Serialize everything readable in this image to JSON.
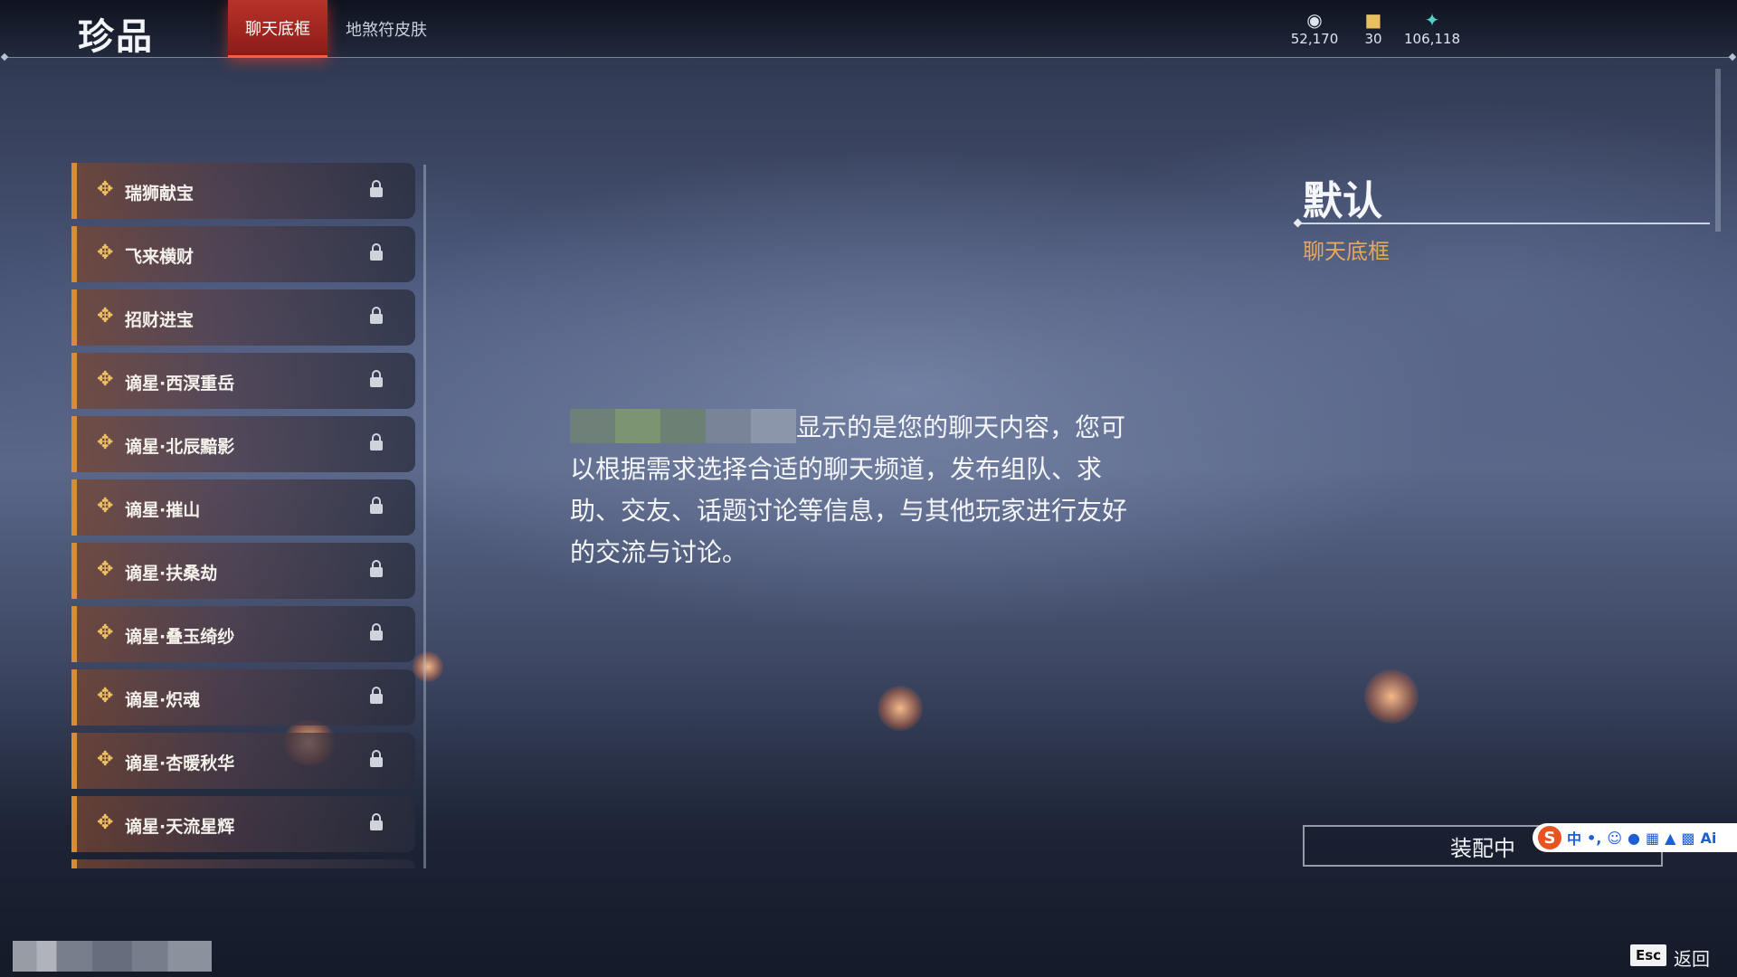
{
  "header": {
    "title": "珍品",
    "tabs": [
      {
        "label": "聊天底框",
        "active": true
      },
      {
        "label": "地煞符皮肤",
        "active": false
      }
    ],
    "currencies": [
      {
        "icon": "coin-icon",
        "value": "52,170"
      },
      {
        "icon": "ticket-icon",
        "value": "30"
      },
      {
        "icon": "feather-icon",
        "value": "106,118"
      }
    ]
  },
  "list": {
    "items": [
      {
        "label": "瑞狮献宝",
        "locked": true
      },
      {
        "label": "飞来横财",
        "locked": true
      },
      {
        "label": "招财进宝",
        "locked": true
      },
      {
        "label": "谪星·西溟重岳",
        "locked": true
      },
      {
        "label": "谪星·北辰黯影",
        "locked": true
      },
      {
        "label": "谪星·摧山",
        "locked": true
      },
      {
        "label": "谪星·扶桑劫",
        "locked": true
      },
      {
        "label": "谪星·叠玉绮纱",
        "locked": true
      },
      {
        "label": "谪星·炽魂",
        "locked": true
      },
      {
        "label": "谪星·杏暖秋华",
        "locked": true
      },
      {
        "label": "谪星·天流星辉",
        "locked": true
      }
    ]
  },
  "preview": {
    "text": "显示的是您的聊天内容，您可以根据需求选择合适的聊天频道，发布组队、求助、交友、话题讨论等信息，与其他玩家进行友好的交流与讨论。"
  },
  "detail": {
    "name": "默认",
    "category": "聊天底框",
    "equip_label": "装配中"
  },
  "ime": {
    "logo": "S",
    "mode": "中",
    "extra": "Ai"
  },
  "footer": {
    "esc_key": "Esc",
    "back_label": "返回"
  },
  "colors": {
    "accent_tab": "#b8322a",
    "item_accent": "#d98a3a",
    "category_text": "#e6a85a"
  }
}
